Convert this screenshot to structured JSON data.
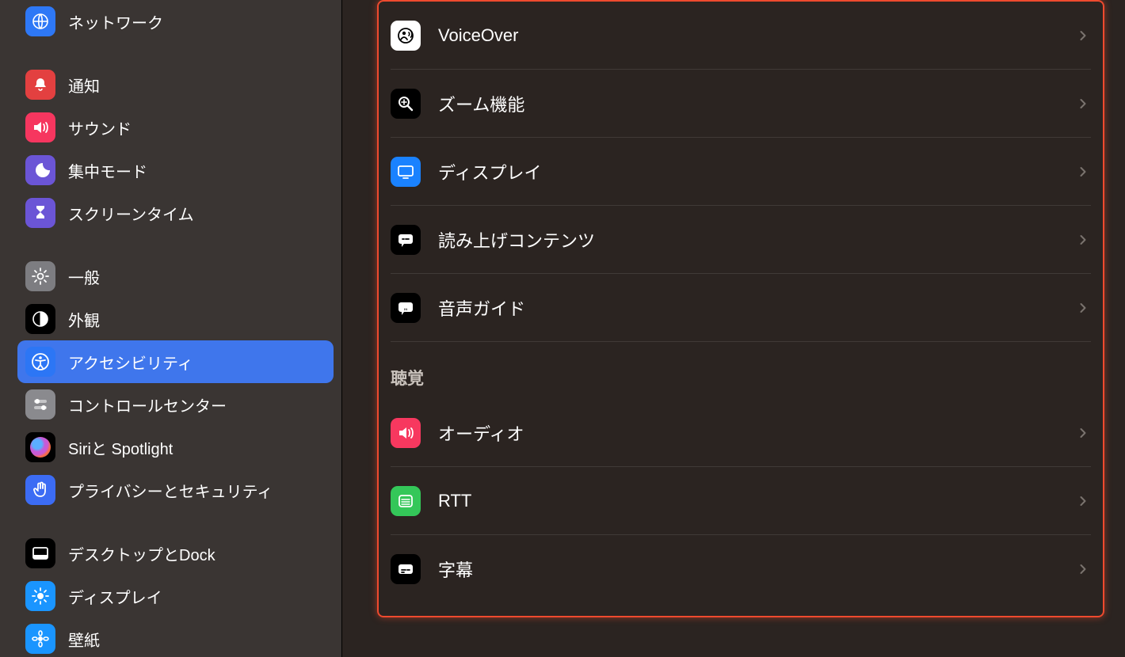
{
  "sidebar": {
    "items": [
      {
        "id": "network",
        "label": "ネットワーク",
        "icon": "globe-icon",
        "bg": "bg-blue"
      },
      {
        "id": "spacer-1",
        "spacer": true
      },
      {
        "id": "notifications",
        "label": "通知",
        "icon": "bell-icon",
        "bg": "bg-red"
      },
      {
        "id": "sound",
        "label": "サウンド",
        "icon": "speaker-icon",
        "bg": "bg-pink"
      },
      {
        "id": "focus",
        "label": "集中モード",
        "icon": "moon-icon",
        "bg": "bg-indigo"
      },
      {
        "id": "screentime",
        "label": "スクリーンタイム",
        "icon": "hourglass-icon",
        "bg": "bg-indigo"
      },
      {
        "id": "spacer-2",
        "spacer": true
      },
      {
        "id": "general",
        "label": "一般",
        "icon": "gear-icon",
        "bg": "bg-grayd"
      },
      {
        "id": "appearance",
        "label": "外観",
        "icon": "contrast-icon",
        "bg": "bg-black"
      },
      {
        "id": "accessibility",
        "label": "アクセシビリティ",
        "icon": "accessibility-icon",
        "bg": "bg-blue2",
        "selected": true
      },
      {
        "id": "controlcenter",
        "label": "コントロールセンター",
        "icon": "switches-icon",
        "bg": "bg-gray2"
      },
      {
        "id": "siri",
        "label": "Siriと Spotlight",
        "icon": "siri-icon",
        "bg": "bg-black"
      },
      {
        "id": "privacy",
        "label": "プライバシーとセキュリティ",
        "icon": "hand-icon",
        "bg": "bg-hand"
      },
      {
        "id": "spacer-3",
        "spacer": true
      },
      {
        "id": "desktop",
        "label": "デスクトップとDock",
        "icon": "dock-icon",
        "bg": "bg-dock"
      },
      {
        "id": "display",
        "label": "ディスプレイ",
        "icon": "brightness-icon",
        "bg": "bg-azure"
      },
      {
        "id": "wallpaper",
        "label": "壁紙",
        "icon": "flower-icon",
        "bg": "bg-azure"
      }
    ]
  },
  "main": {
    "sections": [
      {
        "rows": [
          {
            "id": "voiceover",
            "label": "VoiceOver",
            "icon": "voiceover-icon",
            "bg": "ic-white"
          },
          {
            "id": "zoom",
            "label": "ズーム機能",
            "icon": "magnifier-icon",
            "bg": "ic-black"
          },
          {
            "id": "display",
            "label": "ディスプレイ",
            "icon": "monitor-icon",
            "bg": "ic-blue"
          },
          {
            "id": "spoken",
            "label": "読み上げコンテンツ",
            "icon": "speech-icon",
            "bg": "ic-black"
          },
          {
            "id": "audiodesc",
            "label": "音声ガイド",
            "icon": "audiodesc-icon",
            "bg": "ic-black"
          }
        ]
      },
      {
        "header": "聴覚",
        "rows": [
          {
            "id": "audio",
            "label": "オーディオ",
            "icon": "speaker-icon",
            "bg": "ic-pink"
          },
          {
            "id": "rtt",
            "label": "RTT",
            "icon": "rtt-icon",
            "bg": "ic-green"
          },
          {
            "id": "captions",
            "label": "字幕",
            "icon": "captions-icon",
            "bg": "ic-black"
          }
        ]
      }
    ]
  }
}
